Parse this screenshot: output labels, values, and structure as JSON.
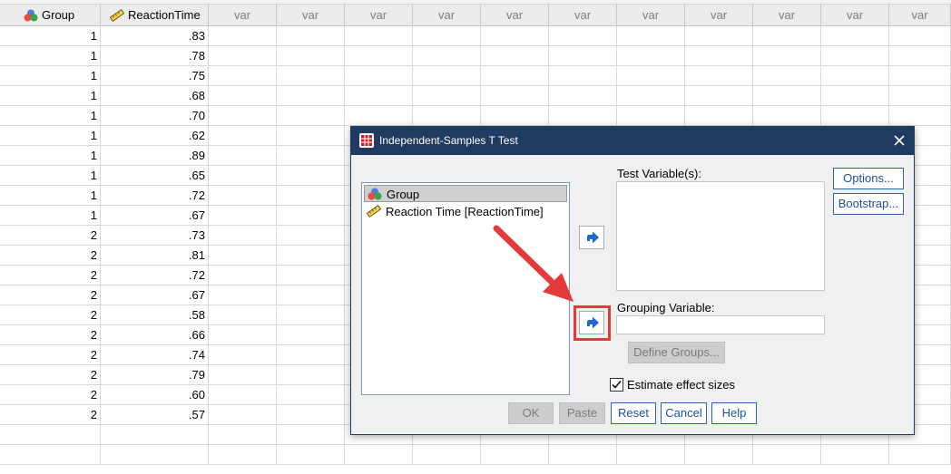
{
  "spreadsheet": {
    "columns": {
      "group": "Group",
      "reaction_time": "ReactionTime",
      "empty_label": "var"
    },
    "rows": [
      [
        "1",
        ".83"
      ],
      [
        "1",
        ".78"
      ],
      [
        "1",
        ".75"
      ],
      [
        "1",
        ".68"
      ],
      [
        "1",
        ".70"
      ],
      [
        "1",
        ".62"
      ],
      [
        "1",
        ".89"
      ],
      [
        "1",
        ".65"
      ],
      [
        "1",
        ".72"
      ],
      [
        "1",
        ".67"
      ],
      [
        "2",
        ".73"
      ],
      [
        "2",
        ".81"
      ],
      [
        "2",
        ".72"
      ],
      [
        "2",
        ".67"
      ],
      [
        "2",
        ".58"
      ],
      [
        "2",
        ".66"
      ],
      [
        "2",
        ".74"
      ],
      [
        "2",
        ".79"
      ],
      [
        "2",
        ".60"
      ],
      [
        "2",
        ".57"
      ],
      [
        "",
        ""
      ],
      [
        "",
        ""
      ]
    ]
  },
  "dialog": {
    "title": "Independent-Samples T Test",
    "variables": [
      {
        "label": "Group",
        "icon": "nominal-icon",
        "selected": true
      },
      {
        "label": "Reaction Time [ReactionTime]",
        "icon": "scale-ruler-icon",
        "selected": false
      }
    ],
    "test_variables_label": "Test Variable(s):",
    "grouping_variable_label": "Grouping Variable:",
    "define_groups_label": "Define Groups...",
    "estimate_effect_sizes_label": "Estimate effect sizes",
    "estimate_effect_sizes_checked": true,
    "options_label": "Options...",
    "bootstrap_label": "Bootstrap...",
    "buttons": {
      "ok": "OK",
      "paste": "Paste",
      "reset": "Reset",
      "cancel": "Cancel",
      "help": "Help"
    }
  },
  "colors": {
    "titlebar": "#1f3b5f",
    "accent": "#2f62a8",
    "annotation": "#e53a3a"
  }
}
